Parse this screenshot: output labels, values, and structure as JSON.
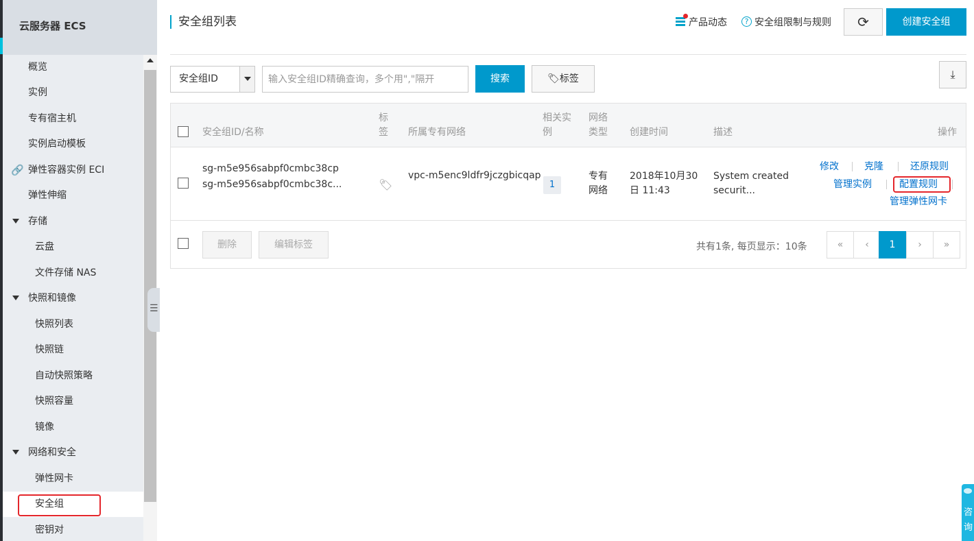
{
  "sidebar": {
    "title": "云服务器 ECS",
    "items": [
      {
        "label": "概览"
      },
      {
        "label": "实例"
      },
      {
        "label": "专有宿主机"
      },
      {
        "label": "实例启动模板"
      },
      {
        "label": "弹性容器实例 ECI",
        "icon": "link-icon"
      },
      {
        "label": "弹性伸缩"
      },
      {
        "label": "存储",
        "group": true
      },
      {
        "label": "云盘"
      },
      {
        "label": "文件存储 NAS"
      },
      {
        "label": "快照和镜像",
        "group": true
      },
      {
        "label": "快照列表"
      },
      {
        "label": "快照链"
      },
      {
        "label": "自动快照策略"
      },
      {
        "label": "快照容量"
      },
      {
        "label": "镜像"
      },
      {
        "label": "网络和安全",
        "group": true
      },
      {
        "label": "弹性网卡"
      },
      {
        "label": "安全组",
        "active": true
      },
      {
        "label": "密钥对"
      }
    ]
  },
  "header": {
    "title": "安全组列表",
    "product_news": "产品动态",
    "limits_link": "安全组限制与规则",
    "create_button": "创建安全组"
  },
  "toolbar": {
    "filter_select": "安全组ID",
    "search_placeholder": "输入安全组ID精确查询，多个用\",\"隔开",
    "search_button": "搜索",
    "tag_button": "标签"
  },
  "table": {
    "columns": {
      "id_name": "安全组ID/名称",
      "tag_1": "标",
      "tag_2": "签",
      "vpc": "所属专有网络",
      "instances_1": "相关实",
      "instances_2": "例",
      "net_type_1": "网络",
      "net_type_2": "类型",
      "created": "创建时间",
      "desc": "描述",
      "ops": "操作"
    },
    "rows": [
      {
        "id": "sg-m5e956sabpf0cmbc38cp",
        "name": "sg-m5e956sabpf0cmbc38c...",
        "vpc": "vpc-m5enc9ldfr9jczgbicqap",
        "instances": "1",
        "net_type_1": "专有",
        "net_type_2": "网络",
        "created_1": "2018年10月30",
        "created_2": "日 11:43",
        "desc_1": "System created",
        "desc_2": "securit...",
        "ops": {
          "modify": "修改",
          "clone": "克隆",
          "restore": "还原规则",
          "manage_instances": "管理实例",
          "config_rules": "配置规则",
          "manage_eni": "管理弹性网卡"
        }
      }
    ],
    "footer": {
      "delete_button": "删除",
      "edit_tags_button": "编辑标签",
      "summary": "共有1条, 每页显示：10条",
      "pager": {
        "first": "«",
        "prev": "‹",
        "current": "1",
        "next": "›",
        "last": "»"
      }
    }
  },
  "consult": {
    "line1": "咨",
    "line2": "询"
  },
  "colors": {
    "primary": "#0099cc",
    "link": "#0070cc",
    "highlight": "#e4262b",
    "sidebar_bg": "#eaedf1"
  }
}
